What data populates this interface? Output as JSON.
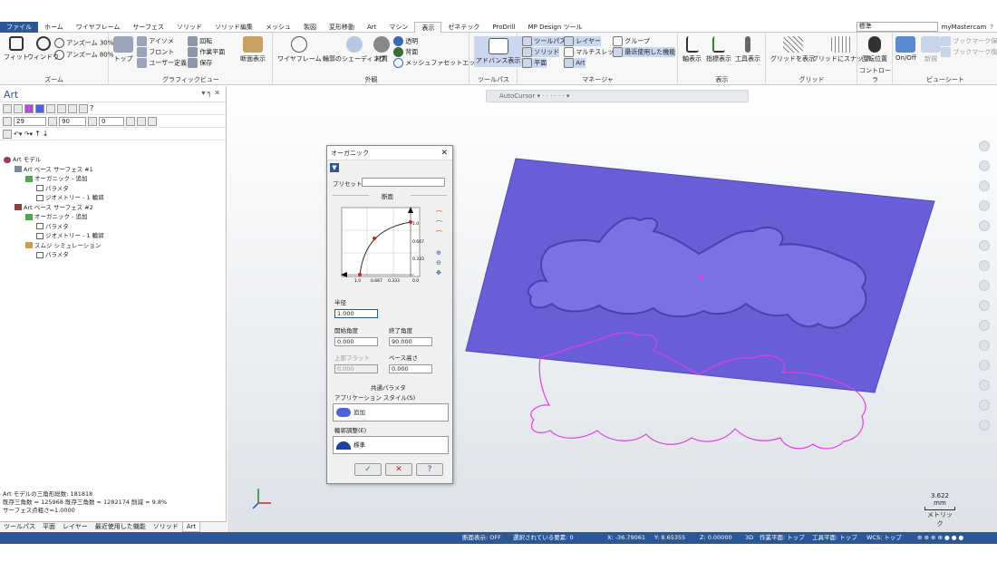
{
  "menu": {
    "tabs": [
      "ファイル",
      "ホーム",
      "ワイヤフレーム",
      "サーフェス",
      "ソリッド",
      "ソリッド編集",
      "メッシュ",
      "製図",
      "変形移動",
      "Art",
      "マシン",
      "表示",
      "ゼネテック",
      "ProDrill",
      "MP Design ツール"
    ],
    "active_tab": "表示",
    "layout_select": "標準",
    "account": "myMastercam"
  },
  "ribbon": {
    "zoom": {
      "label": "ズーム",
      "fit": "フィット",
      "window": "ウィンドウ",
      "unzoom30": "アンズーム 30%",
      "unzoom80": "アンズーム 80%"
    },
    "graphic_view": {
      "label": "グラフィックビュー",
      "top": "トップ",
      "iso": "アイソメ",
      "front": "フロント",
      "user_dir": "ユーザー定義",
      "rotate": "回転",
      "work_plane": "作業平面",
      "save": "保存",
      "section": "断面表示"
    },
    "appearance": {
      "label": "外観",
      "wireframe": "ワイヤフレーム",
      "shading": "輪郭のシェーディング",
      "material": "材質",
      "translucent": "透明",
      "back": "背面",
      "mesh_facet": "メッシュファセットエッジ"
    },
    "toolpath": {
      "label": "ツールパス",
      "advanced": "アドバンス表示"
    },
    "manager": {
      "label": "マネージャ",
      "toolpath": "ツールパス",
      "solid": "ソリッド",
      "plane": "平面",
      "layer": "レイヤー",
      "multithread": "マルチスレッド",
      "art": "Art",
      "group": "グループ",
      "recent": "最近使用した機能"
    },
    "display": {
      "label": "表示",
      "axes": "軸表示",
      "guide": "指標表示",
      "tool": "工具表示"
    },
    "grid": {
      "label": "グリッド",
      "show": "グリッドを表示",
      "snap": "グリッドにスナップ"
    },
    "controller": {
      "label": "コントローラ",
      "position": "回転位置"
    },
    "viewsheet": {
      "label": "ビューシート",
      "onoff": "On/Off",
      "new": "新規",
      "bm_save": "ブックマーク保存",
      "bm_restore": "ブックマーク復元"
    }
  },
  "panel": {
    "title": "Art",
    "angle1": "29",
    "angle2": "90",
    "value3": "0",
    "tree": [
      {
        "label": "Art モデル",
        "indent": 0
      },
      {
        "label": "Art ベース サーフェス #1",
        "indent": 1
      },
      {
        "label": "オーガニック - 追加",
        "indent": 2
      },
      {
        "label": "パラメタ",
        "indent": 3
      },
      {
        "label": "ジオメトリー - 1 輪郭",
        "indent": 3
      },
      {
        "label": "Art ベース サーフェス #2",
        "indent": 1
      },
      {
        "label": "オーガニック - 追加",
        "indent": 2
      },
      {
        "label": "パラメタ",
        "indent": 3
      },
      {
        "label": "ジオメトリー - 1 輪郭",
        "indent": 3
      },
      {
        "label": "スムジ シミュレーション",
        "indent": 2
      },
      {
        "label": "パラメタ",
        "indent": 3
      }
    ],
    "footer": [
      "Art モデルの三角形総数: 181818",
      "既存三角数 = 125968 既存三角数 = 1282174 削減 = 9.8%",
      "サーフェス点粗さ=1.0000"
    ],
    "tabs": [
      "ツールパス",
      "平面",
      "レイヤー",
      "最近使用した機能",
      "ソリッド",
      "Art"
    ]
  },
  "viewport": {
    "autocursor": "AutoCursor",
    "scale_value": "3.622 mm",
    "scale_unit": "メトリック"
  },
  "dialog": {
    "title": "オーガニック",
    "preset_label": "プリセット(P)",
    "section_label": "断面",
    "tick_labels": [
      "1.0",
      "0.667",
      "0.333",
      "0.0"
    ],
    "radius_label": "半径",
    "radius_value": "1.000",
    "start_angle_label": "開始角度",
    "start_angle_value": "0.000",
    "end_angle_label": "終了角度",
    "end_angle_value": "90.000",
    "top_flat_label": "上部フラット",
    "top_flat_value": "0.000",
    "base_height_label": "ベース高さ",
    "base_height_value": "0.000",
    "common_params_label": "共通パラメタ",
    "app_style_label": "アプリケーション スタイル(S)",
    "app_style_value": "追加",
    "contour_label": "輪郭調整(E)",
    "contour_value": "標準",
    "ok": "✓",
    "cancel": "✕",
    "help": "?"
  },
  "status": {
    "section": "断面表示: OFF",
    "selected": "選択されている要素: 0",
    "x": "X: -36.79061",
    "y": "Y: 8.65355",
    "z": "Z: 0.00000",
    "mode": "3D",
    "work_plane": "作業平面: トップ",
    "tool_plane": "工具平面: トップ",
    "wcs": "WCS: トップ"
  },
  "colors": {
    "accent": "#2b5797",
    "plate": "#6a5ed8",
    "contour": "#e040e0"
  }
}
